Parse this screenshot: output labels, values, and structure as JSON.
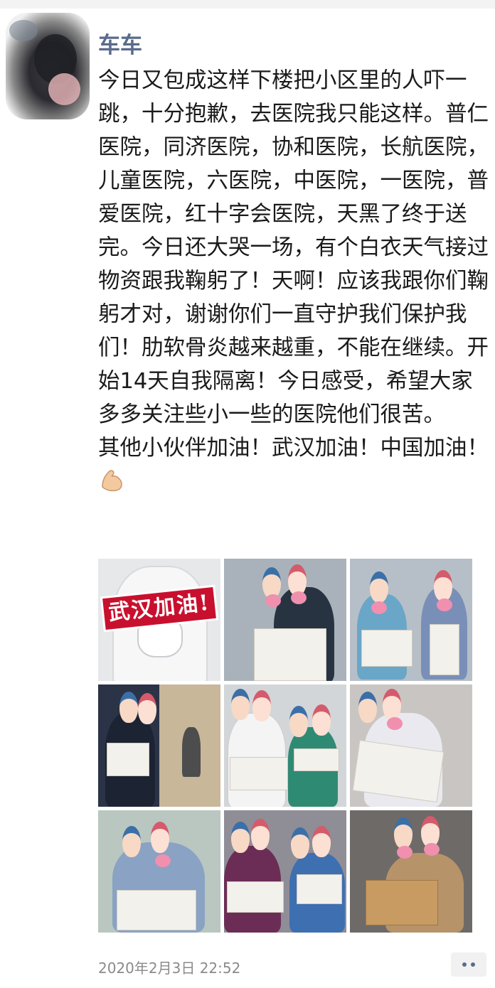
{
  "post": {
    "username": "车车",
    "text": "今日又包成这样下楼把小区里的人吓一跳，十分抱歉，去医院我只能这样。普仁医院，同济医院，协和医院，长航医院，儿童医院，六医院，中医院，一医院，普爱医院，红十字会医院，天黑了终于送完。今日还大哭一场，有个白衣天气接过物资跟我鞠躬了！天啊！应该我跟你们鞠躬才对，谢谢你们一直守护我们保护我们！肋软骨炎越来越重，不能在继续。开始14天自我隔离！今日感受，希望大家多多关注些小一些的医院他们很苦。\n其他小伙伴加油！武汉加油！中国加油！",
    "emoji": "flexed-biceps-emoji",
    "photo_banner": "武汉加油!",
    "timestamp": "2020年2月3日 22:52"
  },
  "colors": {
    "username": "#5b6b8d",
    "text": "#1a1a1a",
    "timestamp": "#8a8a8a",
    "banner": "#c8102e"
  }
}
